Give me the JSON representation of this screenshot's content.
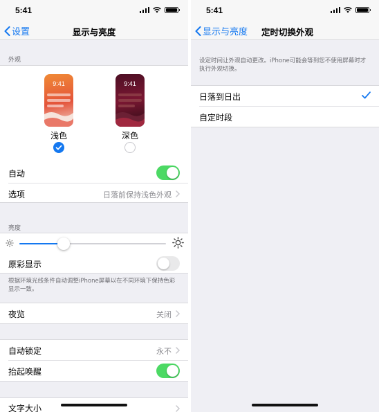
{
  "status_bar": {
    "time": "5:41"
  },
  "left": {
    "nav": {
      "back_label": "设置",
      "title": "显示与亮度"
    },
    "appearance": {
      "header": "外观",
      "light": {
        "label": "浅色",
        "preview_time": "9:41",
        "selected": true
      },
      "dark": {
        "label": "深色",
        "preview_time": "9:41",
        "selected": false
      }
    },
    "auto_row": {
      "label": "自动",
      "on": true
    },
    "options_row": {
      "label": "选项",
      "value": "日落前保持浅色外观"
    },
    "brightness": {
      "header": "亮度",
      "level": 0.3
    },
    "true_tone": {
      "label": "原彩显示",
      "on": false
    },
    "true_tone_note": "根据环境光线条件自动调整iPhone屏幕以在不同环境下保持色彩显示一致。",
    "night_shift": {
      "label": "夜览",
      "value": "关闭"
    },
    "auto_lock": {
      "label": "自动锁定",
      "value": "永不"
    },
    "raise_to_wake": {
      "label": "抬起唤醒",
      "on": true
    },
    "text_size": {
      "label": "文字大小"
    }
  },
  "right": {
    "nav": {
      "back_label": "显示与亮度",
      "title": "定时切换外观"
    },
    "description": "设定时间让外观自动更改。iPhone可能会等到您不使用屏幕时才执行外观切换。",
    "options": [
      {
        "label": "日落到日出",
        "selected": true
      },
      {
        "label": "自定时段",
        "selected": false
      }
    ]
  },
  "colors": {
    "accent": "#1478f0",
    "toggle_on": "#4cd964",
    "background": "#efeff4"
  }
}
